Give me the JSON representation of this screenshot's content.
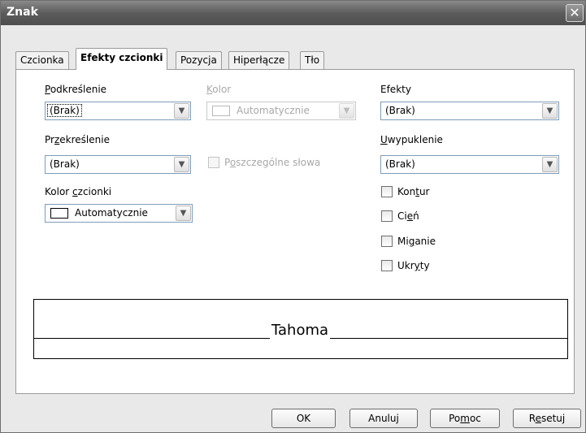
{
  "window": {
    "title": "Znak",
    "close_glyph": "✕"
  },
  "tabs": [
    {
      "label": "Czcionka",
      "active": false
    },
    {
      "label": "Efekty czcionki",
      "active": true
    },
    {
      "label": "Pozycja",
      "active": false
    },
    {
      "label": "Hiperłącze",
      "active": false
    },
    {
      "label": "Tło",
      "active": false
    }
  ],
  "underline": {
    "label_u": "P",
    "label_rest": "odkreślenie",
    "value": "(Brak)"
  },
  "color": {
    "label_u": "K",
    "label_rest": "olor",
    "value": "Automatycznie"
  },
  "strikethrough": {
    "label_pre": "Pr",
    "label_u": "z",
    "label_rest": "ekreślenie",
    "value": "(Brak)"
  },
  "individual_words": {
    "label_u": "o",
    "label_pre": "P",
    "label_rest": "szczególne słowa"
  },
  "font_color": {
    "label_pre": "Kolor ",
    "label_u": "c",
    "label_rest": "zcionki",
    "value": "Automatycznie"
  },
  "effects": {
    "label": "Efekty",
    "value": "(Brak)"
  },
  "relief": {
    "label_u": "U",
    "label_rest": "wypuklenie",
    "value": "(Brak)"
  },
  "checkboxes": {
    "outline": {
      "pre": "Kon",
      "u": "t",
      "rest": "ur"
    },
    "shadow": {
      "pre": "Ci",
      "u": "e",
      "rest": "ń"
    },
    "blink": {
      "pre": "Mi",
      "u": "g",
      "rest": "anie"
    },
    "hidden": {
      "pre": "Ukr",
      "u": "y",
      "rest": "ty"
    }
  },
  "preview": {
    "sample_text": "Tahoma"
  },
  "buttons": {
    "ok": "OK",
    "cancel": "Anuluj",
    "help_pre": "Po",
    "help_u": "m",
    "help_rest": "oc",
    "reset_pre": "R",
    "reset_u": "e",
    "reset_rest": "setuj"
  },
  "icons": {
    "dropdown": "chevron-down-icon",
    "close": "close-icon"
  }
}
